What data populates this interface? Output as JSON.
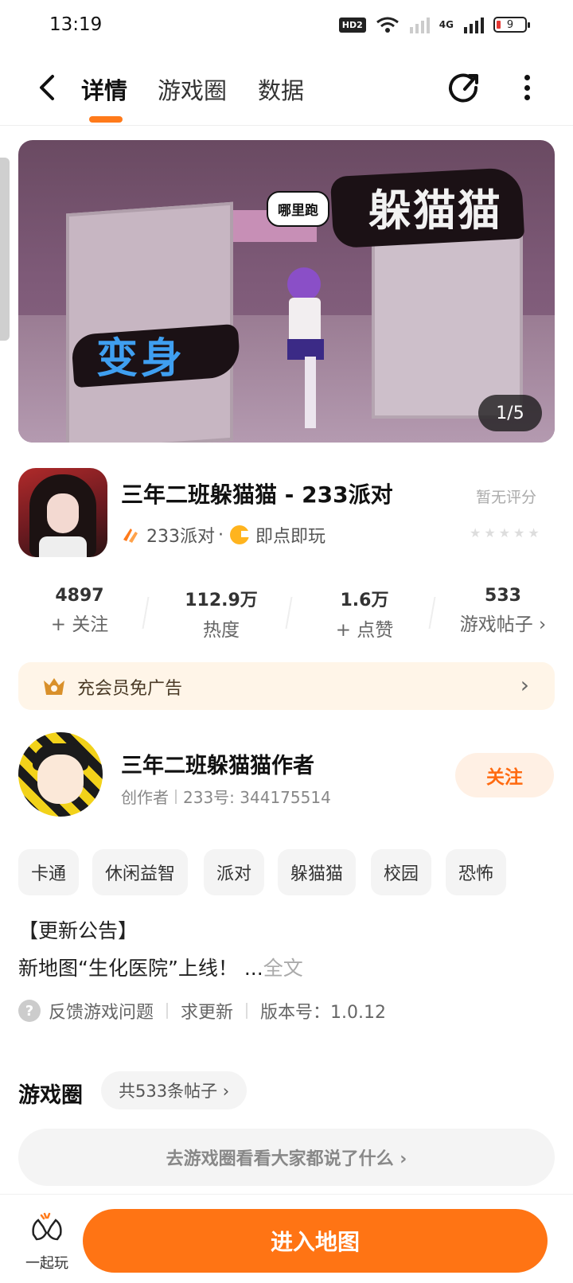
{
  "status_bar": {
    "time": "13:19",
    "hd_label": "HD2",
    "network_label": "4G",
    "battery_level": "9"
  },
  "header": {
    "tabs": [
      {
        "label": "详情",
        "active": true
      },
      {
        "label": "游戏圈",
        "active": false
      },
      {
        "label": "数据",
        "active": false
      }
    ],
    "back_icon": "chevron-left-icon",
    "share_icon": "share-icon",
    "more_icon": "more-vertical-icon",
    "accent_color": "#ff7a1a"
  },
  "banner": {
    "title_right": "躲猫猫",
    "title_left": "变身",
    "speech_bubble": "哪里跑",
    "counter": "1/5"
  },
  "game": {
    "title": "三年二班躲猫猫 - 233派对",
    "developer": "233派对",
    "separator": "·",
    "play_mode": "即点即玩",
    "rating_label": "暂无评分",
    "stars": [
      "★",
      "★",
      "★",
      "★",
      "★"
    ]
  },
  "stats": [
    {
      "value": "4897",
      "label": "+ 关注"
    },
    {
      "value": "112.9万",
      "label": "热度"
    },
    {
      "value": "1.6万",
      "label": "+ 点赞"
    },
    {
      "value": "533",
      "label": "游戏帖子 ›"
    }
  ],
  "member": {
    "text": "充会员免广告",
    "chevron": "›"
  },
  "author": {
    "name": "三年二班躲猫猫作者",
    "role": "创作者",
    "id_text": "233号: 344175514",
    "follow_label": "关注"
  },
  "tags": [
    "卡通",
    "休闲益智",
    "派对",
    "躲猫猫",
    "校园",
    "恐怖"
  ],
  "notice": {
    "title": "【更新公告】",
    "text": "新地图“生化医院”上线！ ...",
    "more_label": "全文"
  },
  "feedback": {
    "question_mark": "?",
    "feedback_label": "反馈游戏问题",
    "update_label": "求更新",
    "version_label": "版本号：1.0.12"
  },
  "game_circle": {
    "title": "游戏圈",
    "count_label": "共533条帖子 ›",
    "go_label": "去游戏圈看看大家都说了什么 ›"
  },
  "bottom": {
    "play_together_label": "一起玩",
    "enter_label": "进入地图",
    "button_color": "#ff7414"
  }
}
